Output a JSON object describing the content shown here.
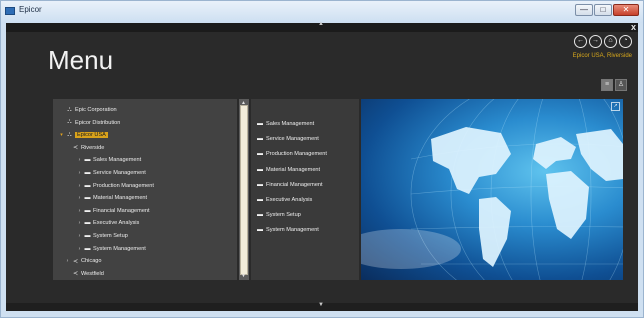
{
  "window": {
    "title": "Epicor",
    "minimize_label": "—",
    "maximize_label": "□",
    "close_label": "✕"
  },
  "app": {
    "close_mark": "x",
    "collapse_arrow": "▲",
    "expand_arrow": "▼"
  },
  "header": {
    "title": "Menu",
    "company": "Epicor USA, Riverside",
    "nav_icons": [
      "back-icon",
      "forward-icon",
      "home-icon",
      "globe-icon"
    ],
    "nav_glyphs": [
      "←",
      "→",
      "⌂",
      "◔"
    ]
  },
  "view_toggle": {
    "list_glyph": "≡",
    "person_glyph": "♙"
  },
  "tree": {
    "items": [
      {
        "label": "Epic Corporation",
        "icon": "org-icon",
        "glyph": "⛬",
        "expander": "",
        "level": 0
      },
      {
        "label": "Epicor Distribution",
        "icon": "org-icon",
        "glyph": "⛬",
        "expander": "",
        "level": 0
      },
      {
        "label": "Epicor USA",
        "icon": "org-icon",
        "glyph": "⛬",
        "expander": "▾",
        "level": 0,
        "selected": true
      },
      {
        "label": "Riverside",
        "icon": "site-icon",
        "glyph": "≺",
        "expander": "",
        "level": 1
      },
      {
        "label": "Sales Management",
        "icon": "folder-icon",
        "glyph": "▬",
        "expander": "›",
        "level": 2
      },
      {
        "label": "Service Management",
        "icon": "folder-icon",
        "glyph": "▬",
        "expander": "›",
        "level": 2
      },
      {
        "label": "Production Management",
        "icon": "folder-icon",
        "glyph": "▬",
        "expander": "›",
        "level": 2
      },
      {
        "label": "Material Management",
        "icon": "folder-icon",
        "glyph": "▬",
        "expander": "›",
        "level": 2
      },
      {
        "label": "Financial Management",
        "icon": "folder-icon",
        "glyph": "▬",
        "expander": "›",
        "level": 2
      },
      {
        "label": "Executive Analysis",
        "icon": "folder-icon",
        "glyph": "▬",
        "expander": "›",
        "level": 2
      },
      {
        "label": "System Setup",
        "icon": "folder-icon",
        "glyph": "▬",
        "expander": "›",
        "level": 2
      },
      {
        "label": "System Management",
        "icon": "folder-icon",
        "glyph": "▬",
        "expander": "›",
        "level": 2
      },
      {
        "label": "Chicago",
        "icon": "site-icon",
        "glyph": "≺",
        "expander": "›",
        "level": 1
      },
      {
        "label": "Westfield",
        "icon": "site-icon",
        "glyph": "≺",
        "expander": "",
        "level": 1
      }
    ],
    "scroll_up": "▲",
    "scroll_down": "▼"
  },
  "list": {
    "items": [
      {
        "label": "Sales Management",
        "icon": "folder-icon",
        "glyph": "▬"
      },
      {
        "label": "Service Management",
        "icon": "folder-icon",
        "glyph": "▬"
      },
      {
        "label": "Production Management",
        "icon": "folder-icon",
        "glyph": "▬"
      },
      {
        "label": "Material Management",
        "icon": "folder-icon",
        "glyph": "▬"
      },
      {
        "label": "Financial Management",
        "icon": "folder-icon",
        "glyph": "▬"
      },
      {
        "label": "Executive Analysis",
        "icon": "folder-icon",
        "glyph": "▬"
      },
      {
        "label": "System Setup",
        "icon": "folder-icon",
        "glyph": "▬"
      },
      {
        "label": "System Management",
        "icon": "folder-icon",
        "glyph": "▬"
      }
    ]
  },
  "image_panel": {
    "corner_glyph": "↗",
    "description_icon": "globe-image"
  },
  "colors": {
    "accent": "#d9a21b",
    "background": "#2a2a2a",
    "panel": "#424242"
  }
}
